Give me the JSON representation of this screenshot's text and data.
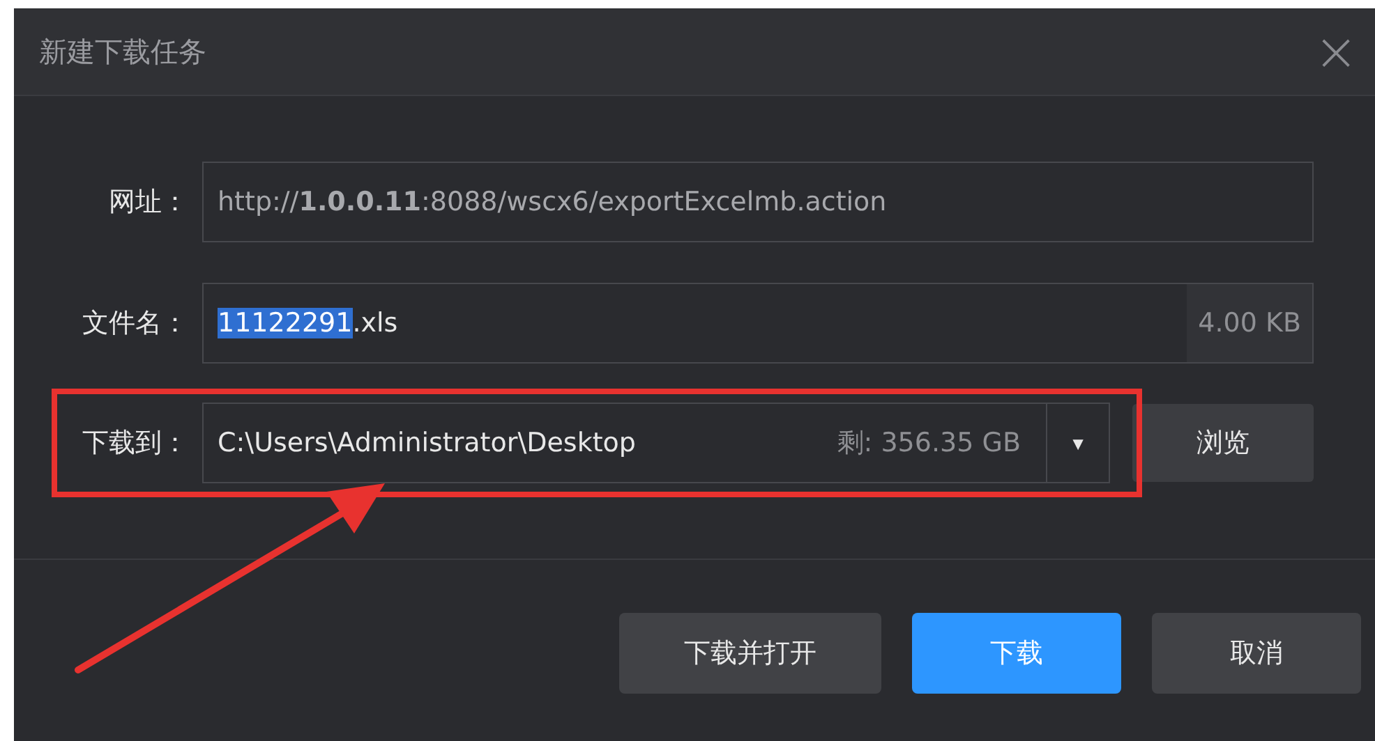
{
  "window": {
    "title": "新建下载任务",
    "close": "×"
  },
  "url": {
    "label": "网址：",
    "value": "http://**1.0.0.11**:8088/wscx6/exportExcelmb.action"
  },
  "filename": {
    "label": "文件名：",
    "selected_part": "11122291",
    "rest": ".xls",
    "size": "4.00 KB"
  },
  "save_to": {
    "label": "下载到：",
    "path": "C:\\Users\\Administrator\\Desktop",
    "free_space": "剩: 356.35 GB",
    "dropdown": "▼",
    "browse": "浏览",
    "highlighted": true
  },
  "buttons": [
    {
      "label": "下载并打开",
      "kind": "secondary"
    },
    {
      "label": "下载",
      "kind": "primary"
    },
    {
      "label": "取消",
      "kind": "secondary"
    }
  ]
}
